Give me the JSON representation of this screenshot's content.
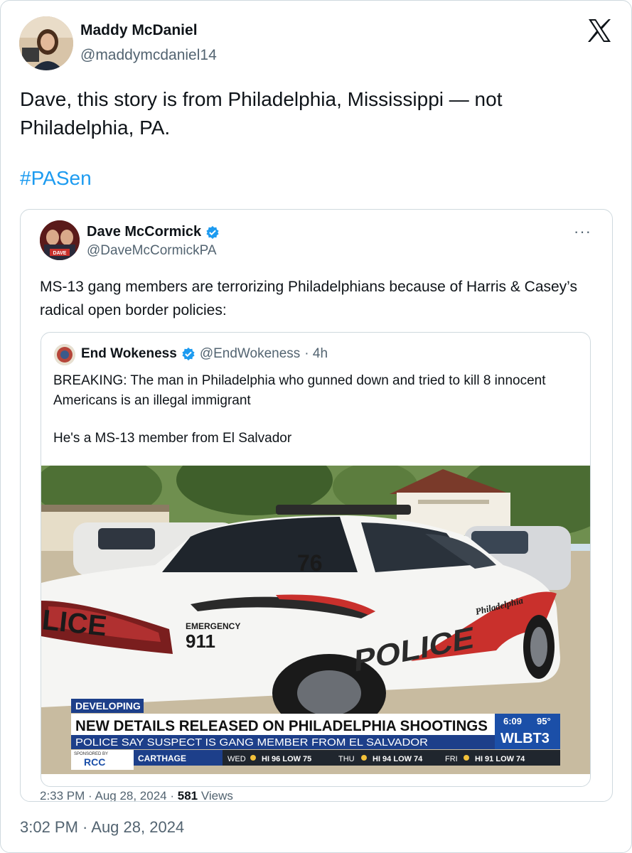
{
  "tweet": {
    "author_name": "Maddy McDaniel",
    "author_handle": "@maddymcdaniel14",
    "text": "Dave, this story is from Philadelphia, Mississippi — not Philadelphia, PA.",
    "hashtag": "#PASen",
    "timestamp": "3:02 PM · Aug 28, 2024",
    "logo_icon": "x-logo-icon"
  },
  "quoted": {
    "author_name": "Dave McCormick",
    "author_handle": "@DaveMcCormickPA",
    "text": "MS-13 gang members are terrorizing Philadelphians because of Harris & Casey’s radical open border policies:",
    "more_icon": "···",
    "avatar_label": "DAVE",
    "footer_time": "2:33 PM · Aug 28, 2024 · ",
    "footer_views_count": "581",
    "footer_views_label": " Views"
  },
  "nested": {
    "author_name": "End Wokeness",
    "author_handle": "@EndWokeness",
    "time": "· 4h",
    "text": "BREAKING: The man in Philadelphia who gunned down and tried to kill 8 innocent Americans is an illegal immigrant",
    "text2": "He's a MS-13 member from El Salvador"
  },
  "media": {
    "car_number": "76",
    "emergency_label": "EMERGENCY",
    "emergency_number": "911",
    "police_text": "POLICE",
    "police_city": "Philadelphia",
    "rear_text": "LICE",
    "chyron_tag": "DEVELOPING",
    "headline": "NEW DETAILS RELEASED ON PHILADELPHIA SHOOTINGS",
    "subheadline": "POLICE SAY SUSPECT IS GANG MEMBER FROM EL SALVADOR",
    "clock": "6:09",
    "temp": "95°",
    "station": "WLBT3",
    "sponsor_label": "SPONSORED BY",
    "sponsor_logo": "RCC",
    "location": "CARTHAGE",
    "forecast": [
      {
        "day": "WED",
        "text": "HI 96 LOW 75"
      },
      {
        "day": "THU",
        "text": "HI 94 LOW 74"
      },
      {
        "day": "FRI",
        "text": "HI 91 LOW 74"
      }
    ],
    "colors": {
      "chyron_blue": "#1d3f8a",
      "police_red": "#c9302c",
      "station_blue": "#1b4fa8"
    }
  },
  "colors": {
    "link": "#1d9bf0",
    "muted": "#536471",
    "verified": "#1d9bf0",
    "border": "#cfd9de"
  }
}
